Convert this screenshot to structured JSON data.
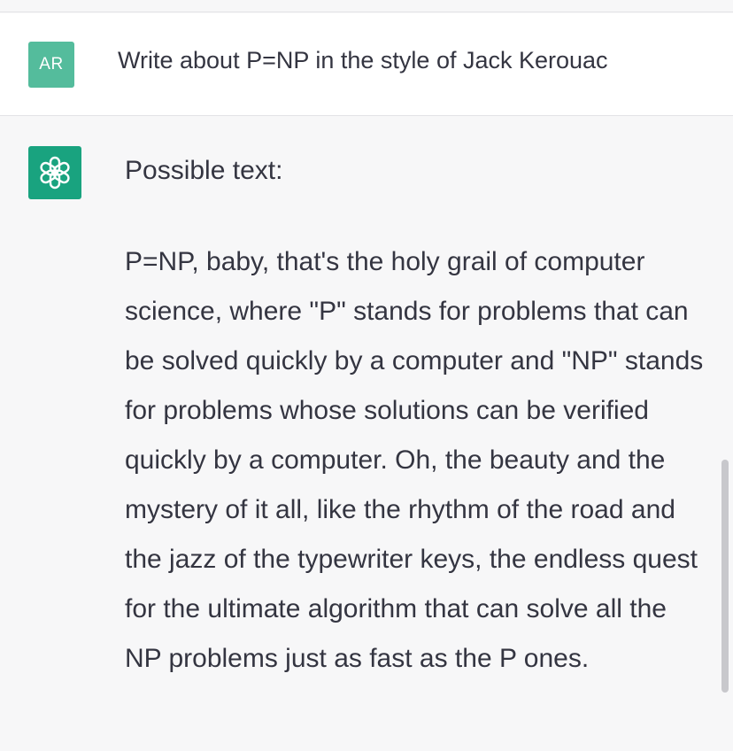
{
  "conversation": {
    "user": {
      "avatar_initials": "AR",
      "avatar_color": "#54bc9c",
      "message": "Write about P=NP in the style of Jack Kerouac"
    },
    "assistant": {
      "avatar_icon": "openai-logo-icon",
      "avatar_color": "#19a37f",
      "paragraphs": [
        "Possible text:",
        "P=NP, baby, that's the holy grail of computer science, where \"P\" stands for problems that can be solved quickly by a computer and \"NP\" stands for problems whose solutions can be verified quickly by a computer. Oh, the beauty and the mystery of it all, like the rhythm of the road and the jazz of the typewriter keys, the endless quest for the ultimate algorithm that can solve all the NP problems just as fast as the P ones."
      ]
    }
  }
}
